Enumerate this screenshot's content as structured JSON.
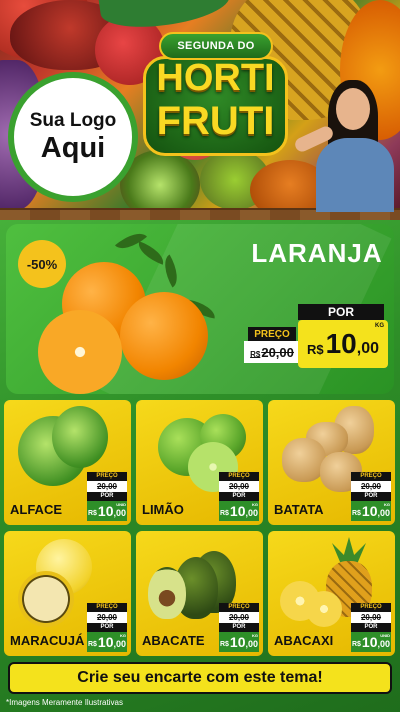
{
  "header": {
    "logo_line1": "Sua Logo",
    "logo_line2": "Aqui",
    "badge_top": "SEGUNDA DO",
    "badge_word1": "HORTI",
    "badge_word2": "FRUTI"
  },
  "featured": {
    "discount": "-50%",
    "name": "LARANJA",
    "old_label": "PREÇO",
    "old_currency": "R$",
    "old_price": "20,00",
    "new_label": "POR",
    "currency": "R$",
    "price_int": "10",
    "price_dec": ",00",
    "unit": "KG"
  },
  "products": [
    {
      "name": "ALFACE",
      "old_label": "PREÇO",
      "old": "20,00",
      "por": "POR",
      "currency": "R$",
      "int": "10",
      "dec": ",00",
      "unit": "UNID"
    },
    {
      "name": "LIMÃO",
      "old_label": "PREÇO",
      "old": "20,00",
      "por": "POR",
      "currency": "R$",
      "int": "10",
      "dec": ",00",
      "unit": "KG"
    },
    {
      "name": "BATATA",
      "old_label": "PREÇO",
      "old": "20,00",
      "por": "POR",
      "currency": "R$",
      "int": "10",
      "dec": ",00",
      "unit": "KG"
    },
    {
      "name": "MARACUJÁ",
      "old_label": "PREÇO",
      "old": "20,00",
      "por": "POR",
      "currency": "R$",
      "int": "10",
      "dec": ",00",
      "unit": "KG"
    },
    {
      "name": "ABACATE",
      "old_label": "PREÇO",
      "old": "20,00",
      "por": "POR",
      "currency": "R$",
      "int": "10",
      "dec": ",00",
      "unit": "KG"
    },
    {
      "name": "ABACAXI",
      "old_label": "PREÇO",
      "old": "20,00",
      "por": "POR",
      "currency": "R$",
      "int": "10",
      "dec": ",00",
      "unit": "UNID"
    }
  ],
  "cta": "Crie seu encarte com este tema!",
  "footnote": "*Imagens Meramente Ilustrativas",
  "colors": {
    "green": "#2e8f28",
    "yellow": "#f4e21c",
    "black": "#111111"
  }
}
